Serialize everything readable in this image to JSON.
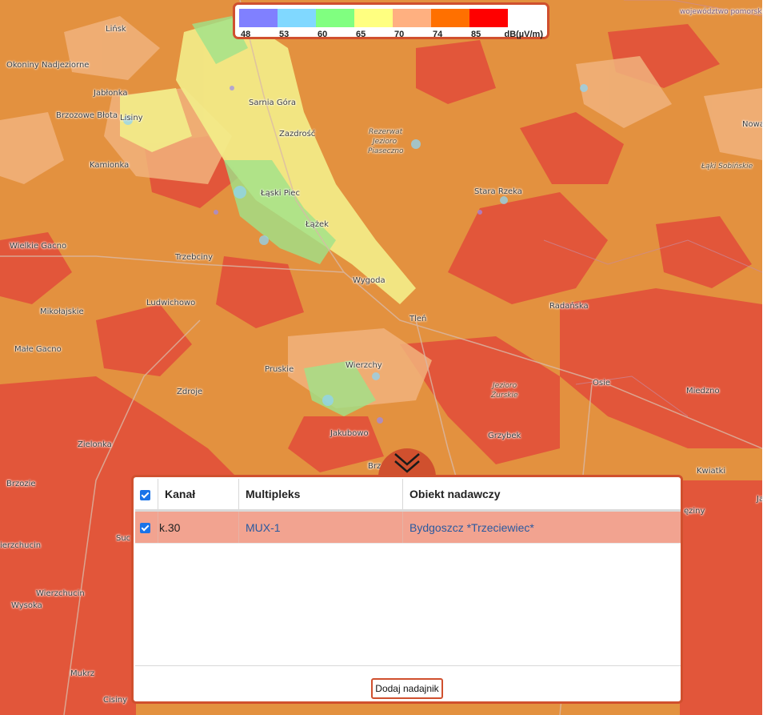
{
  "legend": {
    "stops": [
      {
        "value": "48",
        "color": "#8080ff"
      },
      {
        "value": "53",
        "color": "#80d8ff"
      },
      {
        "value": "60",
        "color": "#80ff80"
      },
      {
        "value": "65",
        "color": "#ffff80"
      },
      {
        "value": "70",
        "color": "#ffb080"
      },
      {
        "value": "74",
        "color": "#ff7000"
      },
      {
        "value": "85",
        "color": "#ff0000"
      }
    ],
    "unit": "dB(µV/m)"
  },
  "map": {
    "places": [
      "Lińsk",
      "Okoniny Nadjeziorne",
      "Jabłonka",
      "Brzozowe Błota",
      "Lisiny",
      "Sarnia Góra",
      "Zazdrość",
      "Rezerwat",
      "Jezioro",
      "Piaseczno",
      "Kamionka",
      "Łąski Piec",
      "Łążek",
      "Stara Rzeka",
      "Trzebciny",
      "Wielkie Gacno",
      "Wygoda",
      "Ludwichowo",
      "Mikołajskie",
      "Radańska",
      "Tleń",
      "Małe Gacno",
      "Pruskie",
      "Wierzchy",
      "Zdroje",
      "Osie",
      "Miedzno",
      "Jezioro",
      "Żurskie",
      "Jakubowo",
      "Grzybek",
      "Zielonka",
      "Brzozie",
      "Kwiatki",
      "Wierzchucin",
      "Wysoka",
      "Mukrz",
      "Cisiny",
      "Nowa",
      "Łąki Sobińskie",
      "województwo pomorskie",
      "Brz",
      "Suc",
      "ierzchucin",
      "ęziny",
      "Ja"
    ]
  },
  "panel": {
    "columns": [
      "Kanał",
      "Multipleks",
      "Obiekt nadawczy"
    ],
    "rows": [
      {
        "channel": "k.30",
        "multiplex": "MUX-1",
        "transmitter": "Bydgoszcz *Trzeciewiec*",
        "checked": true
      }
    ],
    "add_button": "Dodaj nadajnik"
  },
  "colors": {
    "accent": "#d0502e",
    "checkbox": "#1a73e8",
    "row_selected": "#f2a390"
  },
  "icons": {
    "collapse": "double-chevron-down-icon",
    "checkbox": "checkbox-checked-icon"
  }
}
